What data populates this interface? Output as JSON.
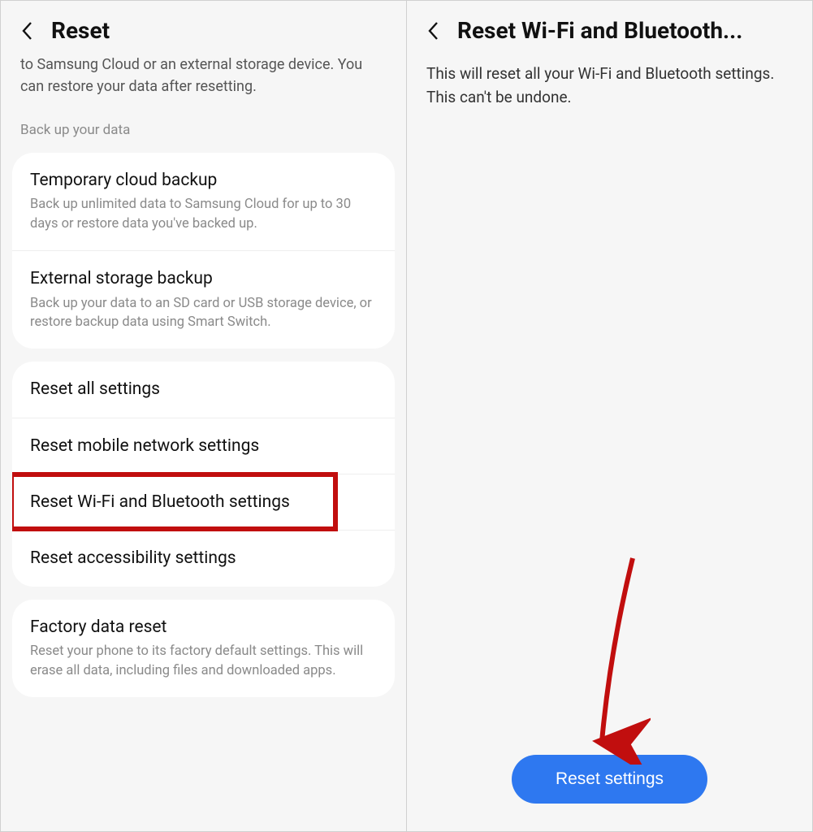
{
  "left": {
    "title": "Reset",
    "intro": "to Samsung Cloud or an external storage device. You can restore your data after resetting.",
    "section_label": "Back up your data",
    "backup_items": [
      {
        "title": "Temporary cloud backup",
        "sub": "Back up unlimited data to Samsung Cloud for up to 30 days or restore data you've backed up."
      },
      {
        "title": "External storage backup",
        "sub": "Back up your data to an SD card or USB storage device, or restore backup data using Smart Switch."
      }
    ],
    "reset_items": [
      {
        "title": "Reset all settings"
      },
      {
        "title": "Reset mobile network settings"
      },
      {
        "title": "Reset Wi-Fi and Bluetooth settings"
      },
      {
        "title": "Reset accessibility settings"
      }
    ],
    "factory": {
      "title": "Factory data reset",
      "sub": "Reset your phone to its factory default settings. This will erase all data, including files and downloaded apps."
    }
  },
  "right": {
    "title": "Reset Wi-Fi and Bluetooth...",
    "body": "This will reset all your Wi-Fi and Bluetooth settings. This can't be undone.",
    "button": "Reset settings"
  }
}
